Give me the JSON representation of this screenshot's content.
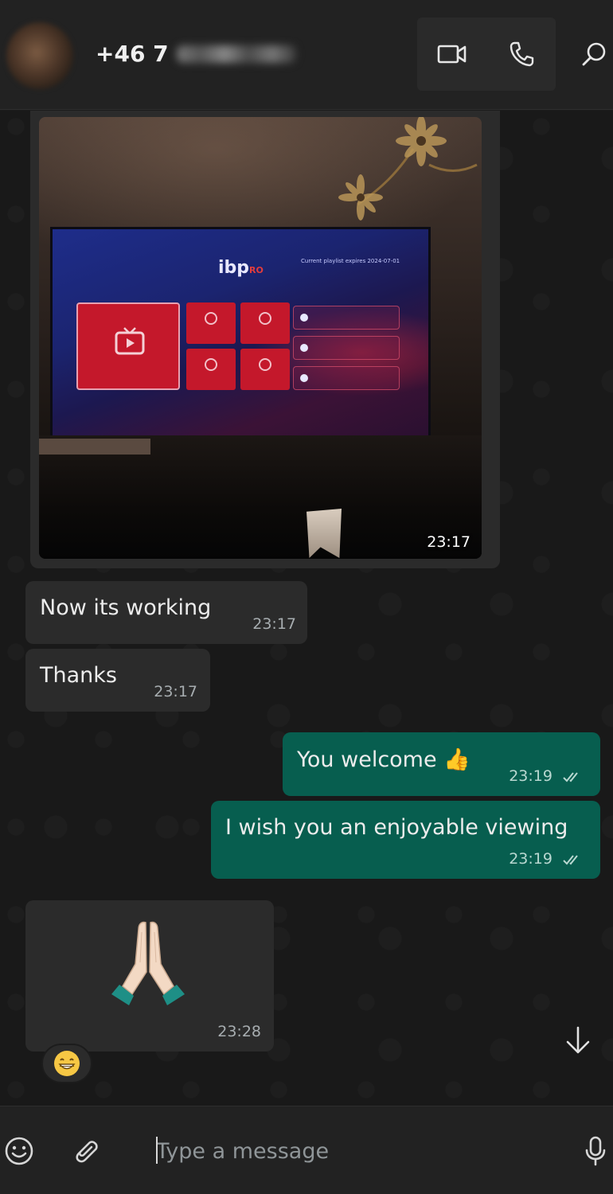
{
  "header": {
    "contact_name_visible": "+46 7",
    "video_call_icon": "video-camera-icon",
    "voice_call_icon": "phone-icon",
    "search_icon": "search-icon"
  },
  "messages": {
    "photo": {
      "time": "23:17",
      "screen_logo_main": "ibp",
      "screen_logo_sub": "RO",
      "screen_note": "Current playlist expires 2024-07-01"
    },
    "in_1": {
      "text": "Now its working",
      "time": "23:17"
    },
    "in_2": {
      "text": "Thanks",
      "time": "23:17"
    },
    "out_1": {
      "text": "You welcome 👍",
      "time": "23:19",
      "status_icon": "double-check-icon"
    },
    "out_2": {
      "text": "I wish you an enjoyable viewing",
      "time": "23:19",
      "status_icon": "double-check-icon"
    },
    "in_3": {
      "emoji": "🙏",
      "time": "23:28"
    },
    "reaction": {
      "emoji": "😁"
    }
  },
  "composer": {
    "placeholder": "Type a message",
    "emoji_icon": "smiley-icon",
    "attach_icon": "paperclip-icon",
    "mic_icon": "microphone-icon"
  },
  "colors": {
    "incoming_bubble": "#2b2b2b",
    "outgoing_bubble": "#075e4f",
    "header_bg": "#222222",
    "chat_bg": "#191919"
  }
}
